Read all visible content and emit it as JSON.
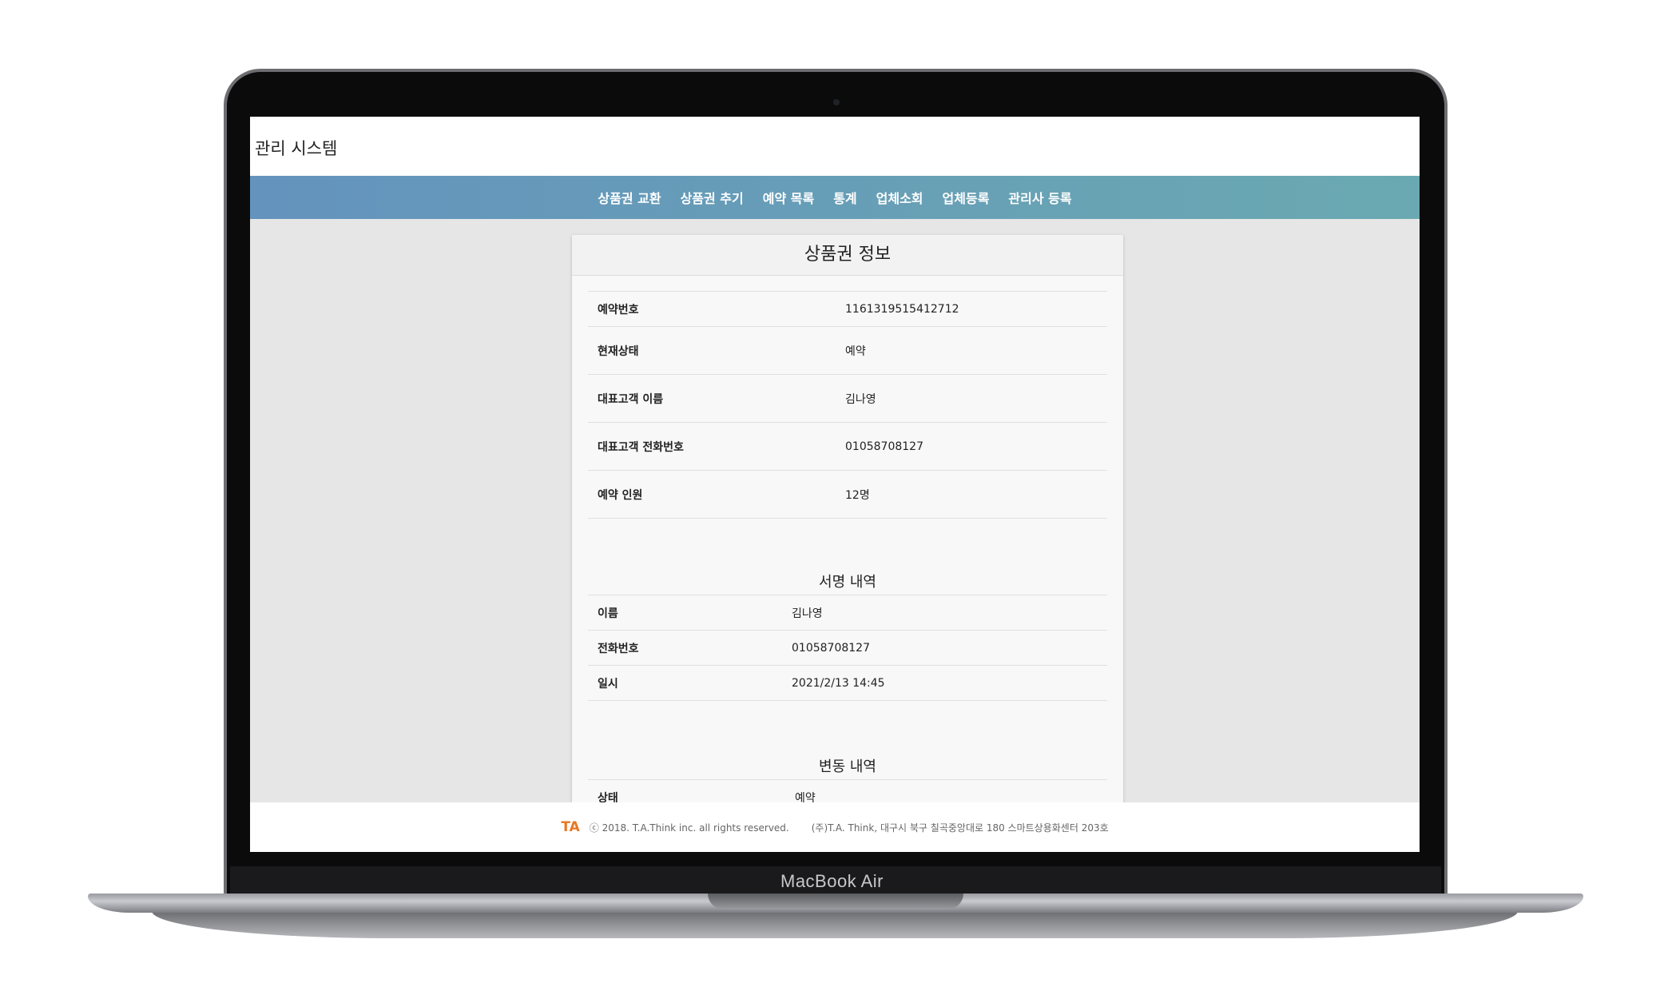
{
  "device": {
    "label": "MacBook Air"
  },
  "app": {
    "title": "관리 시스템"
  },
  "nav": {
    "items": [
      "상품권 교환",
      "상품권 추기",
      "예약 목록",
      "통계",
      "업체소회",
      "업체등록",
      "관리사 등록"
    ]
  },
  "card": {
    "title": "상품권 정보",
    "info_rows": [
      {
        "label": "예약번호",
        "value": "1161319515412712"
      },
      {
        "label": "현재상태",
        "value": "예약"
      },
      {
        "label": "대표고객 이름",
        "value": "김나영"
      },
      {
        "label": "대표고객 전화번호",
        "value": "01058708127"
      },
      {
        "label": "예약 인원",
        "value": "12명"
      }
    ],
    "signature": {
      "title": "서명 내역",
      "rows": [
        {
          "label": "이름",
          "value": "김나영"
        },
        {
          "label": "전화번호",
          "value": "01058708127"
        },
        {
          "label": "일시",
          "value": "2021/2/13 14:45"
        }
      ]
    },
    "change": {
      "title": "변동 내역",
      "rows": [
        {
          "label": "상태",
          "value": "예약"
        }
      ]
    }
  },
  "footer": {
    "logo": "TA",
    "copyright": "ⓒ 2018. T.A.Think inc. all rights reserved.",
    "address": "(주)T.A. Think, 대구시 북구 칠곡중앙대로 180 스마트상용화센터 203호"
  }
}
